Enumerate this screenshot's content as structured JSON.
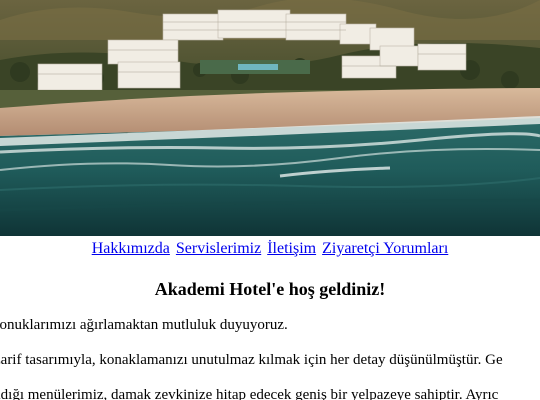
{
  "hero": {
    "image_name": "resort-beach-aerial-photo",
    "colors": {
      "sky_hills": "#5a5a36",
      "vegetation": "#3f4a2a",
      "building": "#f1ede4",
      "sand": "#c9a88a",
      "surf": "#e4ebe9",
      "sea_near": "#0f3436",
      "sea_mid": "#1f5b5a",
      "sea_far": "#2c6b68"
    }
  },
  "nav": {
    "items": [
      {
        "label": "Hakkımızda"
      },
      {
        "label": "Servislerimiz"
      },
      {
        "label": "İletişim"
      },
      {
        "label": "Ziyaretçi Yorumları"
      }
    ]
  },
  "main": {
    "title": "Akademi Hotel'e hoş geldiniz!",
    "paragraphs": [
      "konuklarımızı ağırlamaktan mutluluk duyuyoruz.",
      "zarif tasarımıyla, konaklamanızı unutulmaz kılmak için her detay düşünülmüştür. Ge",
      "adığı menülerimiz, damak zevkinize hitap edecek geniş bir yelpazeye sahiptir. Ayrıc"
    ]
  },
  "colors": {
    "link": "#0000ee",
    "text": "#000000",
    "background": "#ffffff"
  }
}
